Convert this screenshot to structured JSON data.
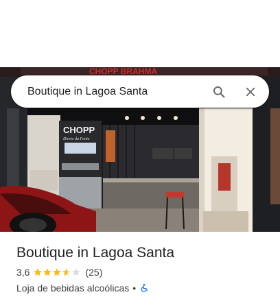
{
  "search": {
    "query": "Boutique in Lagoa Santa"
  },
  "photo": {
    "sign_top": "CHOPP BRAHMA",
    "sign_chopp": "CHOPP",
    "sign_sub": "Direto da Fonte"
  },
  "place": {
    "name": "Boutique in Lagoa Santa",
    "rating": "3,6",
    "rating_value": 3.6,
    "rating_max": 5,
    "review_count": "(25)",
    "category": "Loja de bebidas alcoólicas",
    "separator": "•"
  },
  "colors": {
    "star_filled": "#fbbc04",
    "star_empty": "#dadce0",
    "accessibility_icon": "#1a73e8",
    "title_text": "#202124",
    "secondary_text": "#3c4043"
  },
  "icons": {
    "search": "search-icon",
    "close": "close-icon",
    "accessibility": "wheelchair-icon"
  }
}
